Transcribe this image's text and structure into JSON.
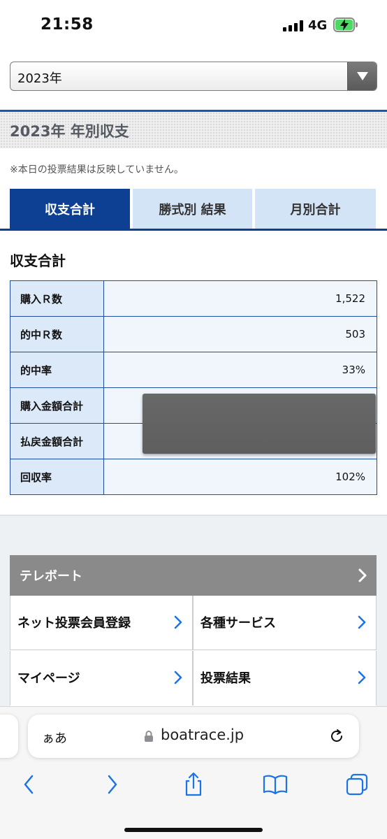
{
  "status_bar": {
    "time": "21:58",
    "network": "4G",
    "battery_color": "#4cd964"
  },
  "year_select": {
    "value": "2023年"
  },
  "heading": {
    "title": "2023年 年別収支"
  },
  "note": "※本日の投票結果は反映していません。",
  "tabs": [
    {
      "label": "収支合計",
      "active": true
    },
    {
      "label": "勝式別 結果",
      "active": false
    },
    {
      "label": "月別合計",
      "active": false
    }
  ],
  "section_title": "収支合計",
  "summary_rows": [
    {
      "label": "購入Ｒ数",
      "value": "1,522"
    },
    {
      "label": "的中Ｒ数",
      "value": "503"
    },
    {
      "label": "的中率",
      "value": "33%"
    },
    {
      "label": "購入金額合計",
      "value": ""
    },
    {
      "label": "払戻金額合計",
      "value": ""
    },
    {
      "label": "回収率",
      "value": "102%"
    }
  ],
  "telebo": {
    "label": "テレボート"
  },
  "links": [
    {
      "label": "ネット投票会員登録"
    },
    {
      "label": "各種サービス"
    },
    {
      "label": "マイページ"
    },
    {
      "label": "投票結果"
    }
  ],
  "safari": {
    "aa_label": "ぁあ",
    "url": "boatrace.jp"
  },
  "colors": {
    "accent": "#0d3f93",
    "tab_inactive": "#d4e4f7",
    "table_border": "#1e4fa3",
    "ios_blue": "#1a73e8"
  },
  "icons": [
    "signal-icon",
    "battery-icon",
    "chevron-down-icon",
    "chevron-right-icon",
    "lock-icon",
    "reload-icon",
    "back-icon",
    "forward-icon",
    "share-icon",
    "bookmarks-icon",
    "tabs-icon"
  ]
}
